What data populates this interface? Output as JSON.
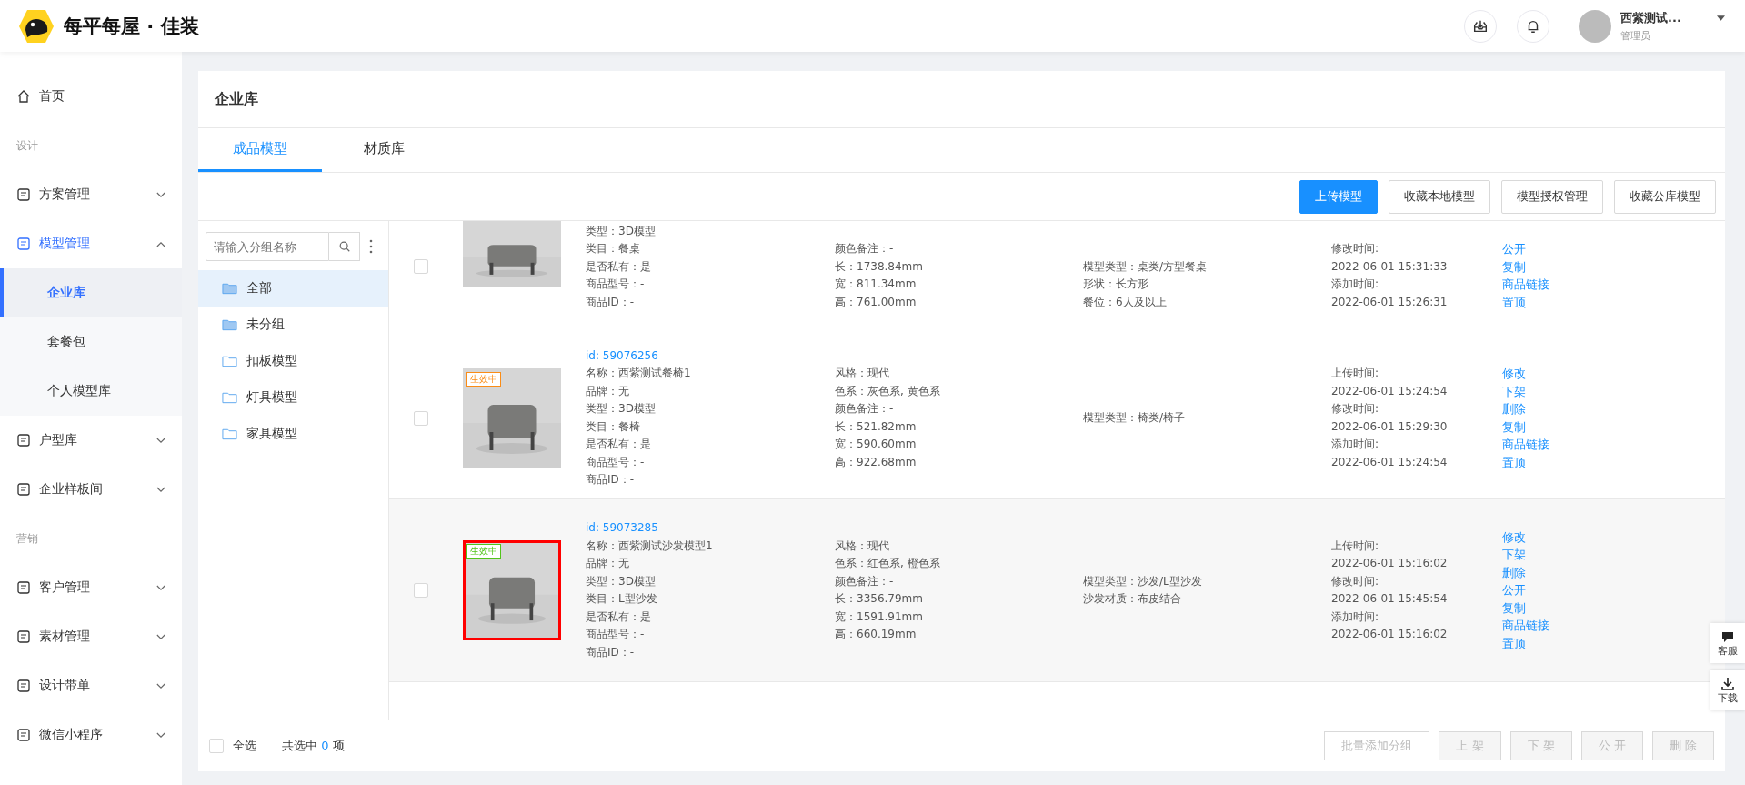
{
  "header": {
    "brand": "每平每屋 · 佳装",
    "user": {
      "name": "西紫测试...",
      "role": "管理员"
    }
  },
  "sidebar": {
    "items": [
      {
        "kind": "item",
        "label": "首页"
      },
      {
        "kind": "section",
        "label": "设计"
      },
      {
        "kind": "group",
        "label": "方案管理",
        "expanded": false,
        "selected": false
      },
      {
        "kind": "group",
        "label": "模型管理",
        "expanded": true,
        "selected": true
      },
      {
        "kind": "sub",
        "label": "企业库",
        "selected": true
      },
      {
        "kind": "sub",
        "label": "套餐包",
        "selected": false
      },
      {
        "kind": "sub",
        "label": "个人模型库",
        "selected": false
      },
      {
        "kind": "group",
        "label": "户型库",
        "expanded": false,
        "selected": false
      },
      {
        "kind": "group",
        "label": "企业样板间",
        "expanded": false,
        "selected": false
      },
      {
        "kind": "section",
        "label": "营销"
      },
      {
        "kind": "group",
        "label": "客户管理",
        "expanded": false,
        "selected": false
      },
      {
        "kind": "group",
        "label": "素材管理",
        "expanded": false,
        "selected": false
      },
      {
        "kind": "group",
        "label": "设计带单",
        "expanded": false,
        "selected": false
      },
      {
        "kind": "group",
        "label": "微信小程序",
        "expanded": false,
        "selected": false
      }
    ]
  },
  "page": {
    "title": "企业库",
    "tabs": [
      {
        "label": "成品模型",
        "selected": true
      },
      {
        "label": "材质库",
        "selected": false
      }
    ],
    "toolbar": [
      {
        "label": "上传模型",
        "primary": true
      },
      {
        "label": "收藏本地模型",
        "primary": false
      },
      {
        "label": "模型授权管理",
        "primary": false
      },
      {
        "label": "收藏公库模型",
        "primary": false
      }
    ],
    "groups": {
      "search": {
        "placeholder": "请输入分组名称"
      },
      "items": [
        {
          "label": "全部",
          "kind": "filled",
          "selected": true
        },
        {
          "label": "未分组",
          "kind": "filled",
          "selected": false
        },
        {
          "label": "扣板模型",
          "kind": "outline",
          "selected": false
        },
        {
          "label": "灯具模型",
          "kind": "outline",
          "selected": false
        },
        {
          "label": "家具模型",
          "kind": "outline",
          "selected": false
        }
      ]
    },
    "models": [
      {
        "checked": false,
        "hover": false,
        "outlined": false,
        "partial": true,
        "info": [
          "类型：3D模型",
          "类目：餐桌",
          "是否私有：是",
          "商品型号：-",
          "商品ID：-"
        ],
        "specs": [
          "颜色备注：-",
          "长：1738.84mm",
          "宽：811.34mm",
          "高：761.00mm"
        ],
        "props": [
          "模型类型：桌类/方型餐桌",
          "形状：长方形",
          "餐位：6人及以上"
        ],
        "times": [
          "修改时间:",
          "2022-06-01 15:31:33",
          "添加时间:",
          "2022-06-01 15:26:31"
        ],
        "actions": [
          "公开",
          "复制",
          "商品链接",
          "置顶"
        ]
      },
      {
        "checked": false,
        "hover": false,
        "outlined": false,
        "partial": false,
        "id": "id:  59076256",
        "badge": {
          "label": "生效中",
          "color": "#fa8c16"
        },
        "info": [
          "名称：西紫测试餐椅1",
          "品牌：无",
          "类型：3D模型",
          "类目：餐椅",
          "是否私有：是",
          "商品型号：-",
          "商品ID：-"
        ],
        "specs": [
          "风格：现代",
          "色系：灰色系, 黄色系",
          "颜色备注：-",
          "长：521.82mm",
          "宽：590.60mm",
          "高：922.68mm"
        ],
        "props": [
          "模型类型：椅类/椅子"
        ],
        "times": [
          "上传时间:",
          "2022-06-01 15:24:54",
          "修改时间:",
          "2022-06-01 15:29:30",
          "添加时间:",
          "2022-06-01 15:24:54"
        ],
        "actions": [
          "修改",
          "下架",
          "删除",
          "复制",
          "商品链接",
          "置顶"
        ]
      },
      {
        "checked": false,
        "hover": true,
        "outlined": true,
        "partial": false,
        "id": "id:  59073285",
        "badge": {
          "label": "生效中",
          "color": "#52c41a"
        },
        "info": [
          "名称：西紫测试沙发模型1",
          "品牌：无",
          "类型：3D模型",
          "类目：L型沙发",
          "是否私有：是",
          "商品型号：-",
          "商品ID：-"
        ],
        "specs": [
          "风格：现代",
          "色系：红色系, 橙色系",
          "颜色备注：-",
          "长：3356.79mm",
          "宽：1591.91mm",
          "高：660.19mm"
        ],
        "props": [
          "模型类型：沙发/L型沙发",
          "沙发材质：布皮结合"
        ],
        "times": [
          "上传时间:",
          "2022-06-01 15:16:02",
          "修改时间:",
          "2022-06-01 15:45:54",
          "添加时间:",
          "2022-06-01 15:16:02"
        ],
        "actions": [
          "修改",
          "下架",
          "删除",
          "公开",
          "复制",
          "商品链接",
          "置顶"
        ]
      }
    ],
    "footer": {
      "select_all": {
        "label": "全选",
        "checked": false
      },
      "count_prefix": "共选中",
      "count": "0",
      "count_suffix": "项",
      "buttons": [
        {
          "label": "批量添加分组",
          "disabled": true
        },
        {
          "label": "上 架",
          "disabled": true
        },
        {
          "label": "下 架",
          "disabled": true
        },
        {
          "label": "公 开",
          "disabled": true
        },
        {
          "label": "删 除",
          "disabled": true
        }
      ]
    }
  },
  "float": [
    {
      "label": "客服",
      "kind": "chat"
    },
    {
      "label": "下载",
      "kind": "download"
    }
  ]
}
